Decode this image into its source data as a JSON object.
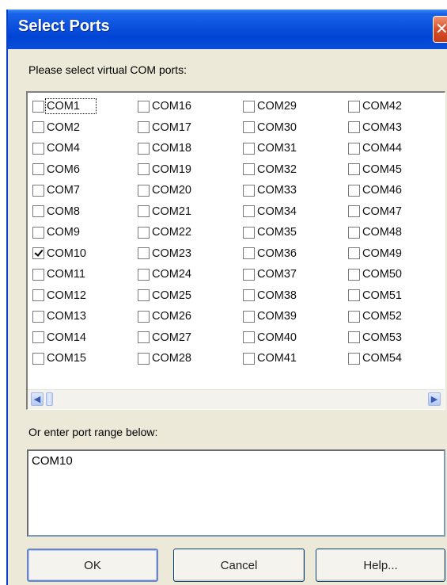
{
  "dialog": {
    "title": "Select Ports",
    "close_glyph": "✕",
    "prompt": "Please select virtual COM ports:",
    "range_label": "Or enter port range below:",
    "range_value": "COM10"
  },
  "ports": [
    {
      "label": "COM1",
      "checked": false,
      "focused": true
    },
    {
      "label": "COM16",
      "checked": false
    },
    {
      "label": "COM29",
      "checked": false
    },
    {
      "label": "COM42",
      "checked": false
    },
    {
      "label": "COM2",
      "checked": false
    },
    {
      "label": "COM17",
      "checked": false
    },
    {
      "label": "COM30",
      "checked": false
    },
    {
      "label": "COM43",
      "checked": false
    },
    {
      "label": "COM4",
      "checked": false
    },
    {
      "label": "COM18",
      "checked": false
    },
    {
      "label": "COM31",
      "checked": false
    },
    {
      "label": "COM44",
      "checked": false
    },
    {
      "label": "COM6",
      "checked": false
    },
    {
      "label": "COM19",
      "checked": false
    },
    {
      "label": "COM32",
      "checked": false
    },
    {
      "label": "COM45",
      "checked": false
    },
    {
      "label": "COM7",
      "checked": false
    },
    {
      "label": "COM20",
      "checked": false
    },
    {
      "label": "COM33",
      "checked": false
    },
    {
      "label": "COM46",
      "checked": false
    },
    {
      "label": "COM8",
      "checked": false
    },
    {
      "label": "COM21",
      "checked": false
    },
    {
      "label": "COM34",
      "checked": false
    },
    {
      "label": "COM47",
      "checked": false
    },
    {
      "label": "COM9",
      "checked": false
    },
    {
      "label": "COM22",
      "checked": false
    },
    {
      "label": "COM35",
      "checked": false
    },
    {
      "label": "COM48",
      "checked": false
    },
    {
      "label": "COM10",
      "checked": true
    },
    {
      "label": "COM23",
      "checked": false
    },
    {
      "label": "COM36",
      "checked": false
    },
    {
      "label": "COM49",
      "checked": false
    },
    {
      "label": "COM11",
      "checked": false
    },
    {
      "label": "COM24",
      "checked": false
    },
    {
      "label": "COM37",
      "checked": false
    },
    {
      "label": "COM50",
      "checked": false
    },
    {
      "label": "COM12",
      "checked": false
    },
    {
      "label": "COM25",
      "checked": false
    },
    {
      "label": "COM38",
      "checked": false
    },
    {
      "label": "COM51",
      "checked": false
    },
    {
      "label": "COM13",
      "checked": false
    },
    {
      "label": "COM26",
      "checked": false
    },
    {
      "label": "COM39",
      "checked": false
    },
    {
      "label": "COM52",
      "checked": false
    },
    {
      "label": "COM14",
      "checked": false
    },
    {
      "label": "COM27",
      "checked": false
    },
    {
      "label": "COM40",
      "checked": false
    },
    {
      "label": "COM53",
      "checked": false
    },
    {
      "label": "COM15",
      "checked": false
    },
    {
      "label": "COM28",
      "checked": false
    },
    {
      "label": "COM41",
      "checked": false
    },
    {
      "label": "COM54",
      "checked": false
    }
  ],
  "scrollbar": {
    "left_arrow": "◀",
    "right_arrow": "▶"
  },
  "buttons": {
    "ok": "OK",
    "cancel": "Cancel",
    "help": "Help..."
  },
  "colors": {
    "titlebar": "#0a50dc",
    "dialog_bg": "#ece9d8",
    "close_button": "#d8502a"
  }
}
